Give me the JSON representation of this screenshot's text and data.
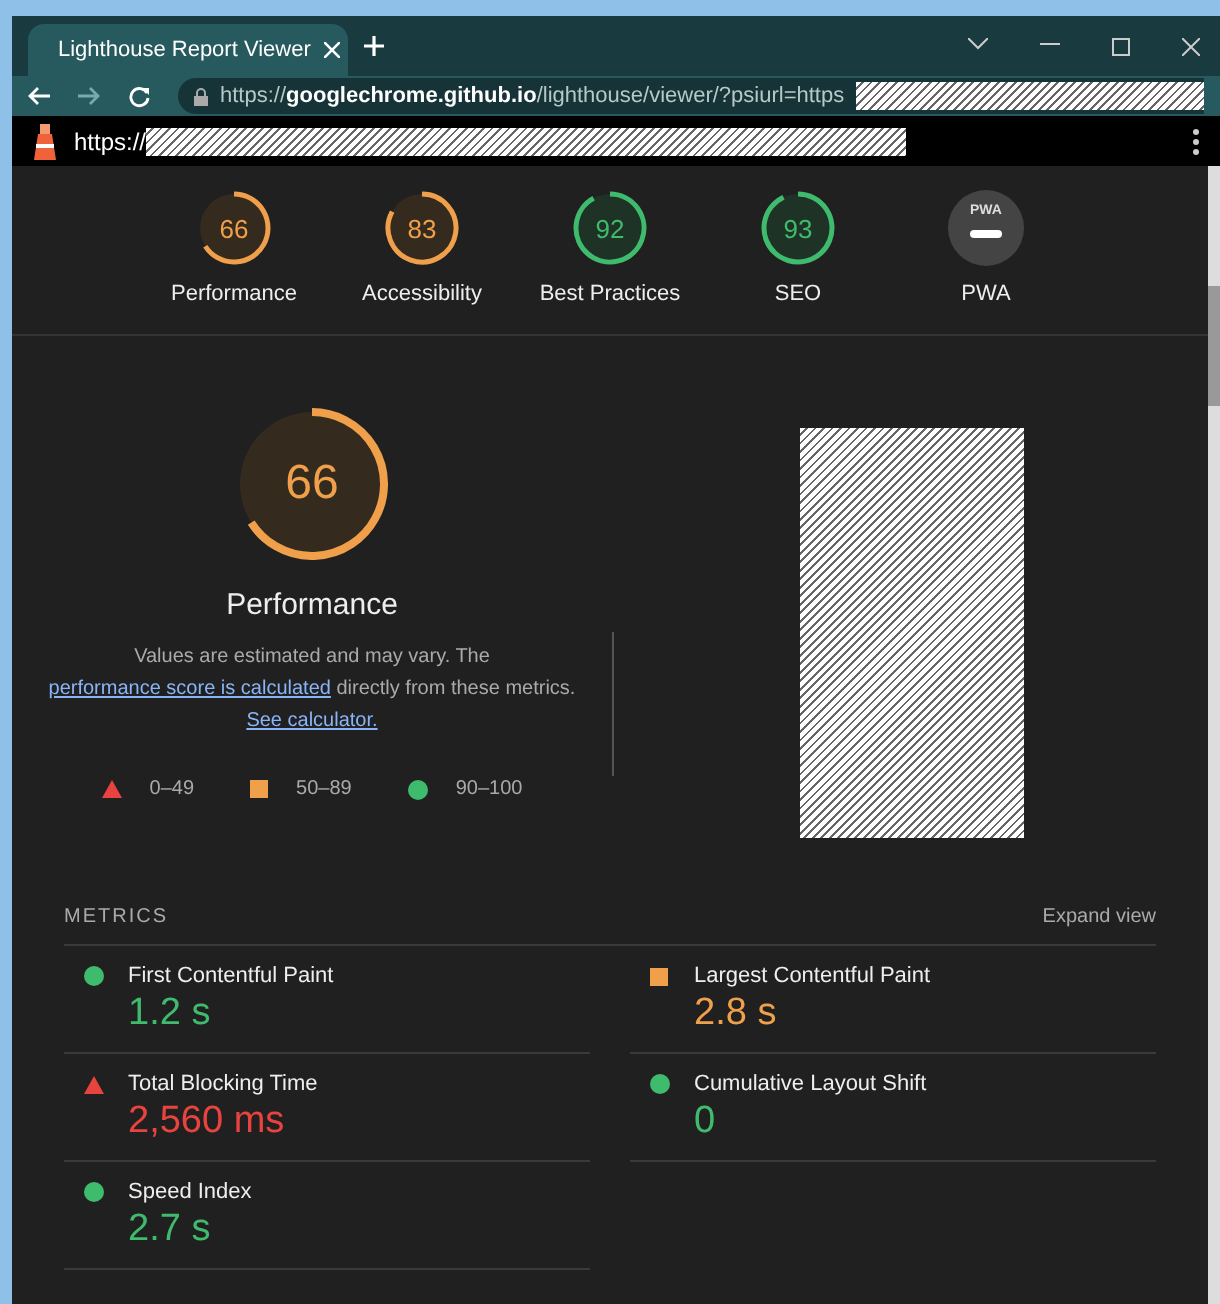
{
  "browser": {
    "tab_title": "Lighthouse Report Viewer",
    "url": "https://**googlechrome.github.io**/lighthouse/viewer/?psiurl=https"
  },
  "report_bar": {
    "url": "https://"
  },
  "gauges": [
    {
      "score": "66",
      "label": "Performance",
      "kind": "average"
    },
    {
      "score": "83",
      "label": "Accessibility",
      "kind": "average"
    },
    {
      "score": "92",
      "label": "Best Practices",
      "kind": "pass"
    },
    {
      "score": "93",
      "label": "SEO",
      "kind": "pass"
    },
    {
      "score": "PWA",
      "label": "PWA",
      "kind": "pwa"
    }
  ],
  "performance": {
    "score": "66",
    "kind": "average",
    "title": "Performance",
    "description": "Values are estimated and may vary. The ",
    "link_1": "performance score is calculated",
    "description_2": " directly from these metrics. ",
    "link_2": "See calculator.",
    "legend": [
      {
        "kind": "fail",
        "range": "0–49"
      },
      {
        "kind": "average",
        "range": "50–89"
      },
      {
        "kind": "pass",
        "range": "90–100"
      }
    ]
  },
  "metrics": {
    "heading": "METRICS",
    "toggle": "Expand view",
    "items": [
      {
        "name": "First Contentful Paint",
        "value": "1.2 s",
        "kind": "pass"
      },
      {
        "name": "Largest Contentful Paint",
        "value": "2.8 s",
        "kind": "average"
      },
      {
        "name": "Total Blocking Time",
        "value": "2,560 ms",
        "kind": "fail"
      },
      {
        "name": "Cumulative Layout Shift",
        "value": "0",
        "kind": "pass"
      },
      {
        "name": "Speed Index",
        "value": "2.7 s",
        "kind": "pass"
      }
    ]
  }
}
